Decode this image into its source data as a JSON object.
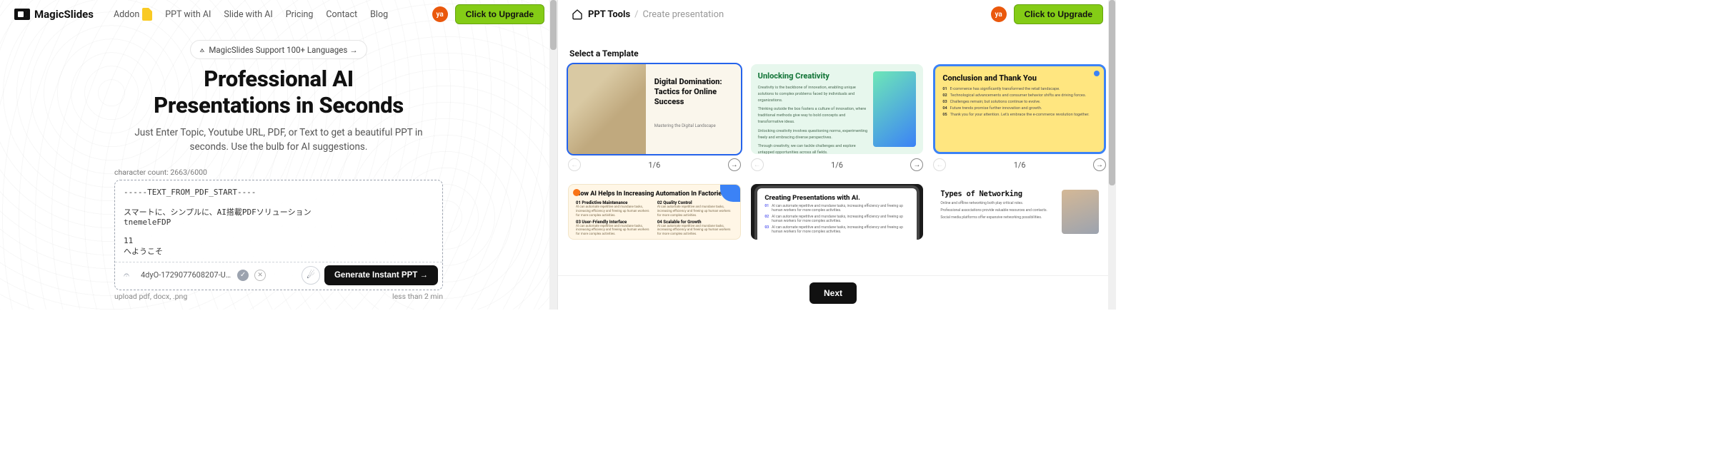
{
  "left": {
    "brand": "MagicSlides",
    "nav": [
      "Addon",
      "PPT with AI",
      "Slide with AI",
      "Pricing",
      "Contact",
      "Blog"
    ],
    "avatar_initials": "ya",
    "upgrade_label": "Click to Upgrade",
    "lang_badge": "MagicSlides Support 100+ Languages →",
    "title_line1": "Professional AI",
    "title_line2": "Presentations in Seconds",
    "subtitle": "Just Enter Topic, Youtube URL, PDF, or Text to get a beautiful PPT in seconds. Use the bulb for AI suggestions.",
    "char_counter": "character count: 2663/6000",
    "textarea_value": "-----TEXT_FROM_PDF_START----\n\nスマートに、シンプルに、AI搭載PDFソリューション\ntnemeleFDP\n\n11\nへようこそ",
    "file_chip": "4dyO-1729077608207-U…",
    "generate_label": "Generate Instant PPT →",
    "upload_hint": "upload pdf, docx, .png",
    "time_hint": "less than 2 min"
  },
  "right": {
    "crumb_root": "PPT Tools",
    "crumb_leaf": "Create presentation",
    "avatar_initials": "ya",
    "upgrade_label": "Click to Upgrade",
    "section_title": "Select a Template",
    "pager_label": "1/6",
    "next_label": "Next",
    "tpl1": {
      "title": "Digital Domination: Tactics for Online Success",
      "sub": "Mastering the Digital Landscape"
    },
    "tpl2": {
      "title": "Unlocking Creativity",
      "b1": "Creativity is the backbone of innovation, enabling unique solutions to complex problems faced by individuals and organizations.",
      "b2": "Thinking outside the box fosters a culture of innovation, where traditional methods give way to bold concepts and transformative ideas.",
      "b3": "Unlocking creativity involves questioning norms, experimenting freely and embracing diverse perspectives.",
      "b4": "Through creativity, we can tackle challenges and explore untapped opportunities across all fields."
    },
    "tpl3": {
      "title": "Conclusion and Thank You",
      "b1": "E-commerce has significantly transformed the retail landscape.",
      "b2": "Technological advancements and consumer behavior shifts are driving forces.",
      "b3": "Challenges remain; but solutions continue to evolve.",
      "b4": "Future trends promise further innovation and growth.",
      "b5": "Thank you for your attention. Let's embrace the e-commerce revolution together."
    },
    "tpl4": {
      "title": "How AI Helps In Increasing Automation In Factories?",
      "h1": "01 Predictive Maintenance",
      "h2": "02 Quality Control",
      "h3": "03 User-Friendly Interface",
      "h4": "04 Scalable for Growth",
      "body": "AI can automate repetitive and mundane tasks, increasing efficiency and freeing up human workers for more complex activities."
    },
    "tpl5": {
      "title": "Creating Presentations with AI.",
      "body": "AI can automate repetitive and mundane tasks, increasing efficiency and freeing up human workers for more complex activities."
    },
    "tpl6": {
      "title": "Types of Networking",
      "b1": "Online and offline networking both play critical roles.",
      "b2": "Professional associations provide valuable resources and contacts.",
      "b3": "Social media platforms offer expansive networking possibilities."
    }
  }
}
